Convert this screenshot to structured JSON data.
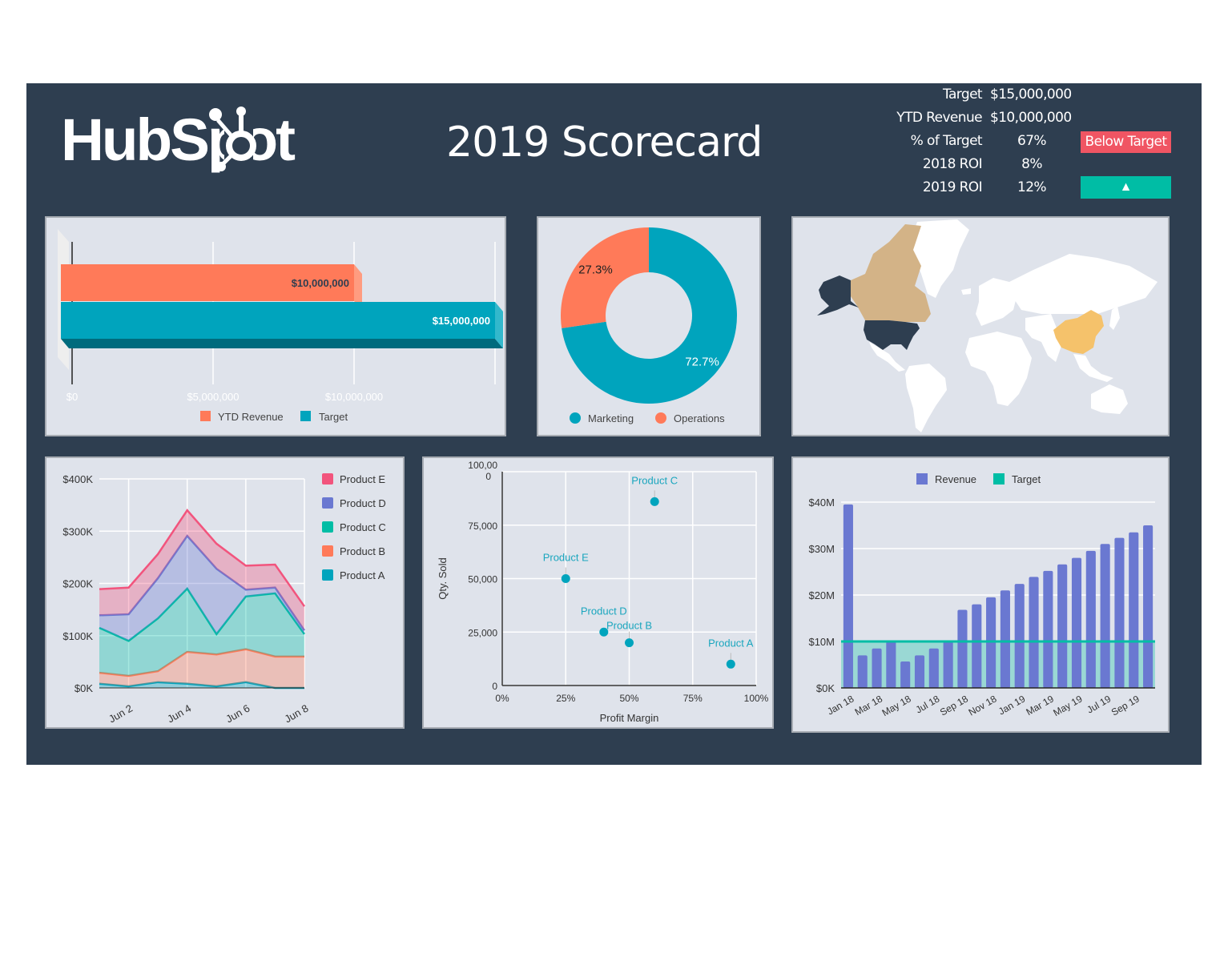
{
  "header": {
    "logo_text": "HubSpot",
    "title": "2019 Scorecard"
  },
  "kpis": [
    {
      "label": "Target",
      "value": "$15,000,000"
    },
    {
      "label": "YTD Revenue",
      "value": "$10,000,000"
    },
    {
      "label": "% of Target",
      "value": "67%",
      "badge": "Below Target"
    },
    {
      "label": "2018 ROI",
      "value": "8%"
    },
    {
      "label": "2019 ROI",
      "value": "12%",
      "badge": "▲"
    }
  ],
  "colors": {
    "background": "#2e3e50",
    "panel": "#dfe3eb",
    "orange": "#ff7a59",
    "teal": "#00a4bd",
    "pink": "#f2547d",
    "purple": "#6a78d1",
    "green": "#00bda5",
    "red_badge": "#f05563",
    "canada": "#d3b387",
    "china": "#f5c26b",
    "usa": "#2e3e50"
  },
  "chart_data": [
    {
      "id": "ytd-vs-target",
      "type": "bar",
      "orientation": "horizontal",
      "categories": [
        "YTD Revenue",
        "Target"
      ],
      "values": [
        10000000,
        15000000
      ],
      "data_labels": [
        "$10,000,000",
        "$15,000,000"
      ],
      "xlim": [
        0,
        15000000
      ],
      "x_ticks": [
        0,
        5000000,
        10000000
      ],
      "x_tick_labels": [
        "$0",
        "$5,000,000",
        "$10,000,000"
      ],
      "legend": [
        "YTD Revenue",
        "Target"
      ],
      "legend_position": "bottom",
      "style": "3d"
    },
    {
      "id": "spend-split",
      "type": "pie",
      "donut": true,
      "categories": [
        "Marketing",
        "Operations"
      ],
      "values": [
        72.7,
        27.3
      ],
      "data_labels": [
        "72.7%",
        "27.3%"
      ],
      "legend_position": "bottom"
    },
    {
      "id": "world-map",
      "type": "heatmap",
      "kind": "geo",
      "highlighted_regions": [
        {
          "region": "United States",
          "color_key": "usa"
        },
        {
          "region": "Canada",
          "color_key": "canada"
        },
        {
          "region": "China",
          "color_key": "china"
        }
      ]
    },
    {
      "id": "product-sales",
      "type": "area",
      "stacked": true,
      "x": [
        "Jun 1",
        "Jun 2",
        "Jun 3",
        "Jun 4",
        "Jun 5",
        "Jun 6",
        "Jun 7",
        "Jun 8"
      ],
      "x_tick_labels": [
        "Jun 2",
        "Jun 4",
        "Jun 6",
        "Jun 8"
      ],
      "y_unit": "K",
      "ylim": [
        0,
        400
      ],
      "y_ticks": [
        0,
        100,
        200,
        300,
        400
      ],
      "y_tick_labels": [
        "$0K",
        "$100K",
        "$200K",
        "$300K",
        "$400K"
      ],
      "series": [
        {
          "name": "Product A",
          "values": [
            8,
            3,
            11,
            8,
            3,
            11,
            0,
            0
          ]
        },
        {
          "name": "Product B",
          "values": [
            21,
            20,
            21,
            61,
            61,
            63,
            60,
            60
          ]
        },
        {
          "name": "Product C",
          "values": [
            86,
            67,
            101,
            121,
            39,
            101,
            121,
            43
          ]
        },
        {
          "name": "Product D",
          "values": [
            24,
            51,
            77,
            101,
            125,
            13,
            11,
            7
          ]
        },
        {
          "name": "Product E",
          "values": [
            50,
            51,
            46,
            49,
            48,
            46,
            44,
            46
          ]
        }
      ],
      "legend": [
        "Product E",
        "Product D",
        "Product C",
        "Product B",
        "Product A"
      ],
      "legend_position": "right",
      "grid": true
    },
    {
      "id": "margin-vs-qty",
      "type": "scatter",
      "xlabel": "Profit Margin",
      "ylabel": "Qty. Sold",
      "xlim": [
        0,
        100
      ],
      "ylim": [
        0,
        100000
      ],
      "x_tick_labels": [
        "0%",
        "25%",
        "50%",
        "75%",
        "100%"
      ],
      "y_tick_labels": [
        "0",
        "25,000",
        "50,000",
        "75,000",
        "100,00\n0"
      ],
      "points": [
        {
          "label": "Product C",
          "x": 60,
          "y": 86000
        },
        {
          "label": "Product E",
          "x": 25,
          "y": 50000
        },
        {
          "label": "Product D",
          "x": 40,
          "y": 25000
        },
        {
          "label": "Product B",
          "x": 50,
          "y": 20000
        },
        {
          "label": "Product A",
          "x": 90,
          "y": 10000
        }
      ],
      "grid": true
    },
    {
      "id": "revenue-vs-target",
      "type": "bar",
      "categories": [
        "Jan 18",
        "Feb 18",
        "Mar 18",
        "Apr 18",
        "May 18",
        "Jun 18",
        "Jul 18",
        "Aug 18",
        "Sep 18",
        "Oct 18",
        "Nov 18",
        "Dec 18",
        "Jan 19",
        "Feb 19",
        "Mar 19",
        "Apr 19",
        "May 19",
        "Jun 19",
        "Jul 19",
        "Aug 19",
        "Sep 19",
        "Oct 19"
      ],
      "x_tick_labels": [
        "Jan 18",
        "Mar 18",
        "May 18",
        "Jul 18",
        "Sep 18",
        "Nov 18",
        "Jan 19",
        "Mar 19",
        "May 19",
        "Jul 19",
        "Sep 19"
      ],
      "series": [
        {
          "name": "Revenue",
          "type": "bar",
          "values": [
            39.5,
            7,
            8.5,
            10,
            5.7,
            7,
            8.5,
            10,
            16.8,
            18,
            19.5,
            21,
            22.4,
            23.9,
            25.2,
            26.6,
            28,
            29.5,
            31,
            32.3,
            33.5,
            35
          ]
        },
        {
          "name": "Target",
          "type": "area",
          "values": [
            10,
            10,
            10,
            10,
            10,
            10,
            10,
            10,
            10,
            10,
            10,
            10,
            10,
            10,
            10,
            10,
            10,
            10,
            10,
            10,
            10,
            10
          ]
        }
      ],
      "y_unit": "M",
      "ylim": [
        0,
        40
      ],
      "y_tick_labels": [
        "$0K",
        "$10M",
        "$20M",
        "$30M",
        "$40M"
      ],
      "legend": [
        "Revenue",
        "Target"
      ],
      "legend_position": "top",
      "grid": true
    }
  ]
}
